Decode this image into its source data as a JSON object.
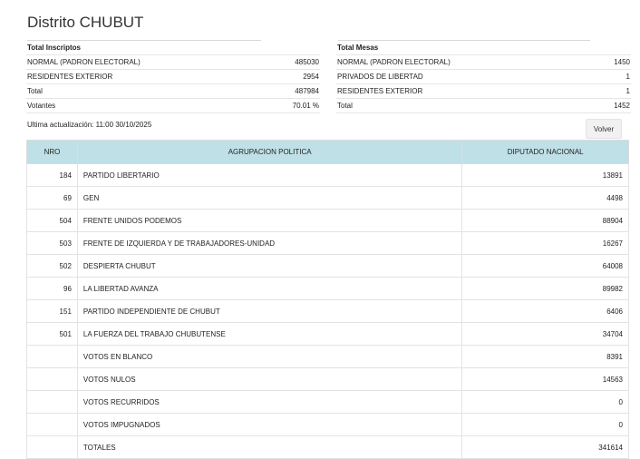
{
  "page": {
    "title": "Distrito CHUBUT"
  },
  "inscriptos": {
    "header": "Total Inscriptos",
    "rows": [
      {
        "label": "NORMAL (PADRON ELECTORAL)",
        "value": "485030"
      },
      {
        "label": "RESIDENTES EXTERIOR",
        "value": "2954"
      },
      {
        "label": "Total",
        "value": "487984"
      },
      {
        "label": "Votantes",
        "value": "70.01 %"
      }
    ]
  },
  "mesas": {
    "header": "Total Mesas",
    "rows": [
      {
        "label": "NORMAL (PADRON ELECTORAL)",
        "value": "1450"
      },
      {
        "label": "PRIVADOS DE LIBERTAD",
        "value": "1"
      },
      {
        "label": "RESIDENTES EXTERIOR",
        "value": "1"
      },
      {
        "label": "Total",
        "value": "1452"
      }
    ]
  },
  "update": {
    "text": "Ultima actualización: 11:00 30/10/2025"
  },
  "actions": {
    "volver_label": "Volver"
  },
  "results": {
    "columns": [
      "NRO",
      "AGRUPACION POLITICA",
      "DIPUTADO NACIONAL"
    ],
    "rows": [
      {
        "nro": "184",
        "name": "PARTIDO LIBERTARIO",
        "votes": "13891"
      },
      {
        "nro": "69",
        "name": "GEN",
        "votes": "4498"
      },
      {
        "nro": "504",
        "name": "FRENTE UNIDOS PODEMOS",
        "votes": "88904"
      },
      {
        "nro": "503",
        "name": "FRENTE DE IZQUIERDA Y DE TRABAJADORES-UNIDAD",
        "votes": "16267"
      },
      {
        "nro": "502",
        "name": "DESPIERTA CHUBUT",
        "votes": "64008"
      },
      {
        "nro": "96",
        "name": "LA LIBERTAD AVANZA",
        "votes": "89982"
      },
      {
        "nro": "151",
        "name": "PARTIDO INDEPENDIENTE DE CHUBUT",
        "votes": "6406"
      },
      {
        "nro": "501",
        "name": "LA FUERZA DEL TRABAJO CHUBUTENSE",
        "votes": "34704"
      },
      {
        "nro": "",
        "name": "VOTOS EN BLANCO",
        "votes": "8391"
      },
      {
        "nro": "",
        "name": "VOTOS NULOS",
        "votes": "14563"
      },
      {
        "nro": "",
        "name": "VOTOS RECURRIDOS",
        "votes": "0"
      },
      {
        "nro": "",
        "name": "VOTOS IMPUGNADOS",
        "votes": "0"
      },
      {
        "nro": "",
        "name": "TOTALES",
        "votes": "341614"
      }
    ]
  },
  "colors": {
    "header_bg": "#bfe0e7",
    "border": "#e3e3e3"
  }
}
